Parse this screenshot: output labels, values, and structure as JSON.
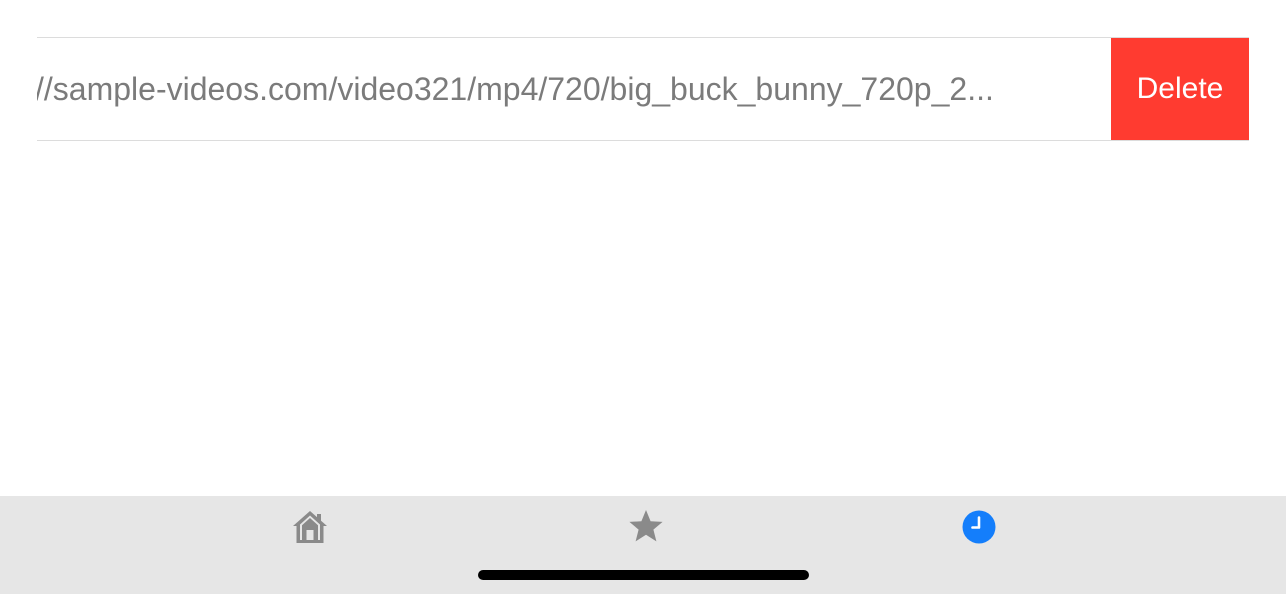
{
  "list": {
    "rows": [
      {
        "url_text": "//sample-videos.com/video321/mp4/720/big_buck_bunny_720p_2...",
        "delete_label": "Delete"
      }
    ]
  },
  "tabbar": {
    "tabs": [
      {
        "icon": "home-icon",
        "selected": false
      },
      {
        "icon": "star-icon",
        "selected": false
      },
      {
        "icon": "clock-icon",
        "selected": true
      }
    ]
  },
  "colors": {
    "delete": "#ff3b30",
    "tab_inactive": "#8a8a8a",
    "tab_active": "#147efb",
    "tabbar_background": "#e6e6e6",
    "text": "#7b7b7b"
  }
}
